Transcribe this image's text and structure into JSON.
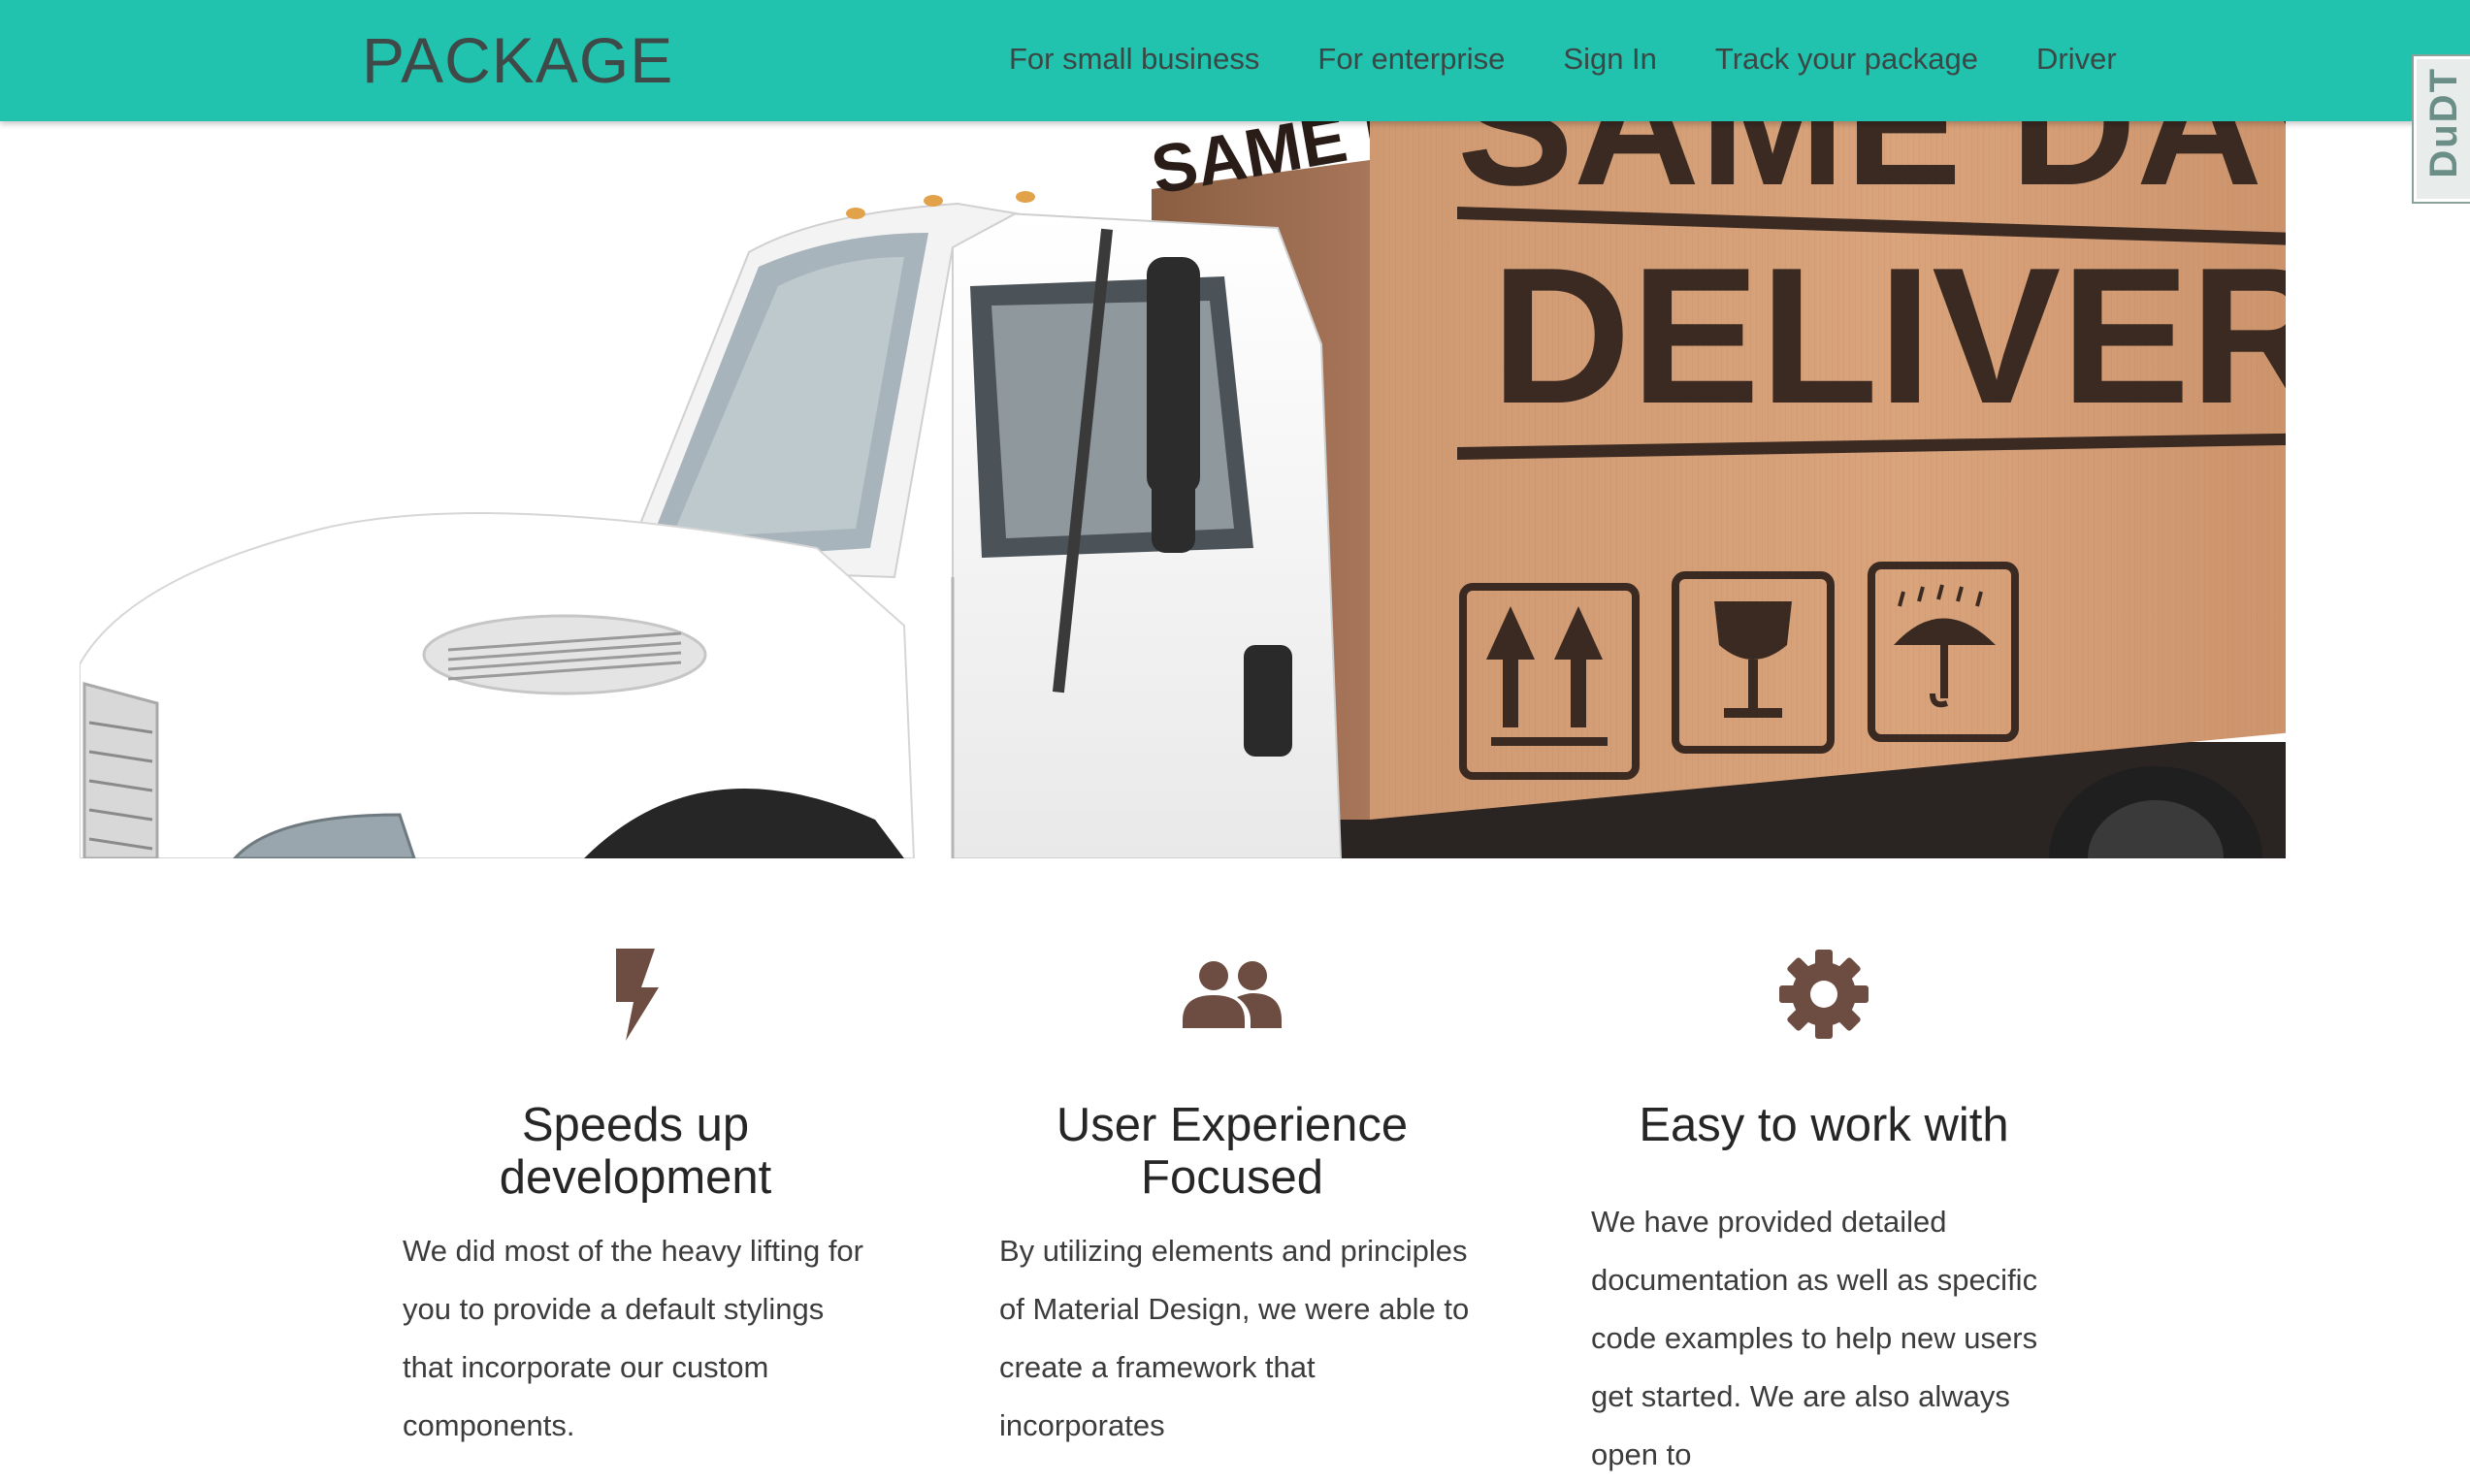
{
  "navbar": {
    "brand": "PACKAGE",
    "links": [
      "For small business",
      "For enterprise",
      "Sign In",
      "Track your package",
      "Driver"
    ],
    "background": "#21c2ae"
  },
  "side_widget": {
    "label": "DuDT"
  },
  "hero": {
    "truck_text_top": "SAME DAY",
    "truck_text_main": "DELIVERY",
    "truck_side_text": "SAME DAY"
  },
  "features": [
    {
      "icon": "flash-icon",
      "title": "Speeds up development",
      "text": "We did most of the heavy lifting for you to provide a default stylings that incorporate our custom components."
    },
    {
      "icon": "group-icon",
      "title": "User Experience Focused",
      "text": "By utilizing elements and principles of Material Design, we were able to create a framework that incorporates"
    },
    {
      "icon": "settings-icon",
      "title": "Easy to work with",
      "text": "We have provided detailed documentation as well as specific code examples to help new users get started. We are also always open to"
    }
  ],
  "colors": {
    "accent": "#21c2ae",
    "icon": "#6d4c41"
  }
}
